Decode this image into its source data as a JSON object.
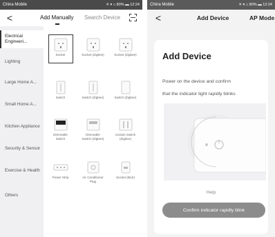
{
  "left": {
    "status": {
      "carrier": "China Mobile",
      "right": "✕ ▾ ⌂ 80% ▬ 12:24"
    },
    "header": {
      "back": "<",
      "tab_manual": "Add Manually",
      "tab_search": "Search Device"
    },
    "categories": [
      "Electrical Engineeri...",
      "Lighting",
      "Large Home A...",
      "Small Home A...",
      "Kitchen Appliance",
      "Security & Sensor",
      "Exercise & Health",
      "Others"
    ],
    "devices": [
      "Socket",
      "Socket (Zigbee)",
      "Socket (Zigbee)",
      "Switch",
      "Switch (Zigbee)",
      "Switch (Zigbee)",
      "Dimmable Switch",
      "Dimmable Switch (Zigbee)",
      "Curtain Switch (Zigbee)",
      "Power Strip",
      "Air Conditioner Plug",
      "Socket (BLE)"
    ]
  },
  "right": {
    "status": {
      "carrier": "China Mobile",
      "right": "✕ ▾ ⌂ 80% ▬ 12:24"
    },
    "header": {
      "back": "<",
      "title": "Add Device",
      "ap_mode": "AP Mode"
    },
    "card": {
      "title": "Add Device",
      "desc_line1": "Power on the device and confirm",
      "desc_line2": "that the indicator light rapidly blinks",
      "help": "Help",
      "confirm": "Confirm indicator rapidly blink"
    }
  }
}
